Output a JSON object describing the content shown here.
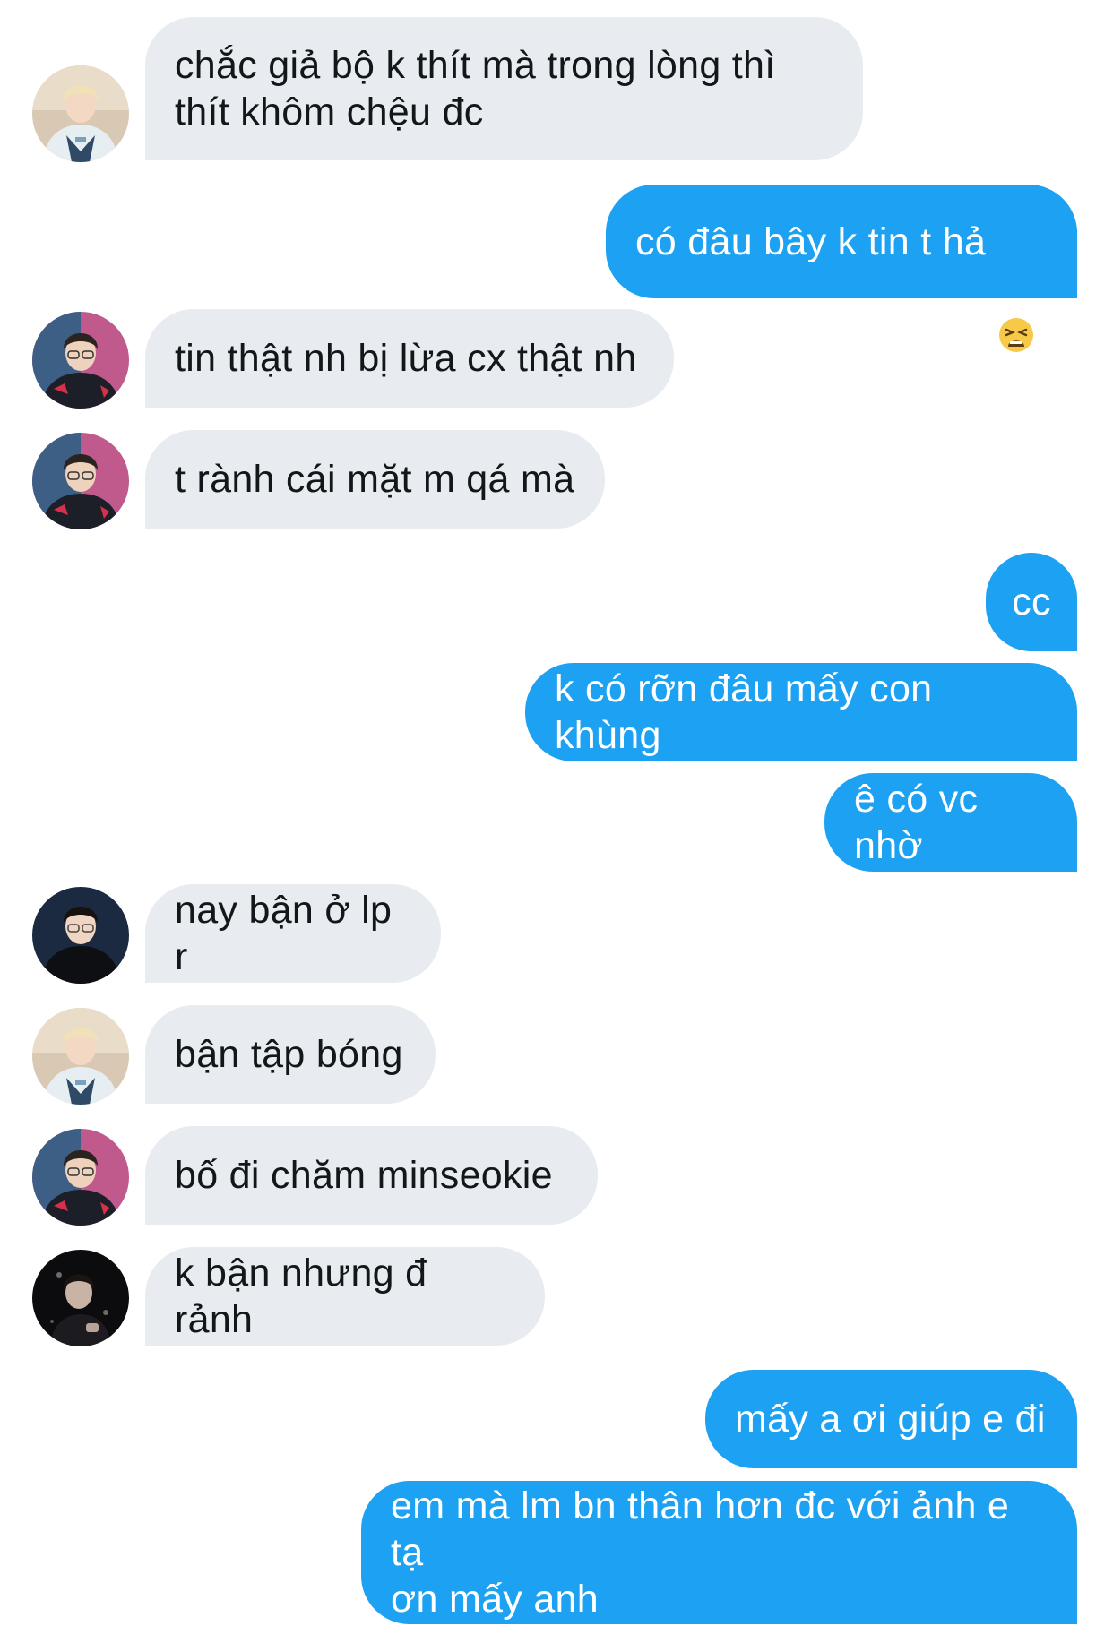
{
  "messages": [
    {
      "dir": "in",
      "avatar": "avatar-blond-white-jacket",
      "text": "chắc giả bộ k thít mà trong lòng thì\nthít khôm chệu đc"
    },
    {
      "dir": "out",
      "text": "có đâu bây k tin t hả",
      "emoji": "tired-face-emoji"
    },
    {
      "dir": "in",
      "avatar": "avatar-glasses-red-jersey",
      "text": "tin thật nh bị lừa cx thật nh"
    },
    {
      "dir": "in",
      "avatar": "avatar-glasses-red-jersey",
      "text": "t rành cái mặt m qá mà"
    },
    {
      "dir": "out",
      "text": "cc"
    },
    {
      "dir": "out",
      "text": "k có rỡn đâu mấy con khùng"
    },
    {
      "dir": "out",
      "text": "ê có vc nhờ"
    },
    {
      "dir": "in",
      "avatar": "avatar-black-hoodie",
      "text": "nay bận ở lp r"
    },
    {
      "dir": "in",
      "avatar": "avatar-blond-white-jacket",
      "text": "bận tập bóng"
    },
    {
      "dir": "in",
      "avatar": "avatar-glasses-red-jersey",
      "text": "bố đi chăm minseokie"
    },
    {
      "dir": "in",
      "avatar": "avatar-dark-portrait",
      "text": "k bận nhưng đ rảnh"
    },
    {
      "dir": "out",
      "text": "mấy a ơi giúp e đi"
    },
    {
      "dir": "out",
      "text": "em mà lm bn thân hơn đc với ảnh e tạ\nơn mấy anh"
    }
  ],
  "colors": {
    "incoming_bubble": "#e8ecf0",
    "incoming_text": "#14171a",
    "outgoing_bubble": "#1da1f2",
    "outgoing_text": "#ffffff"
  }
}
